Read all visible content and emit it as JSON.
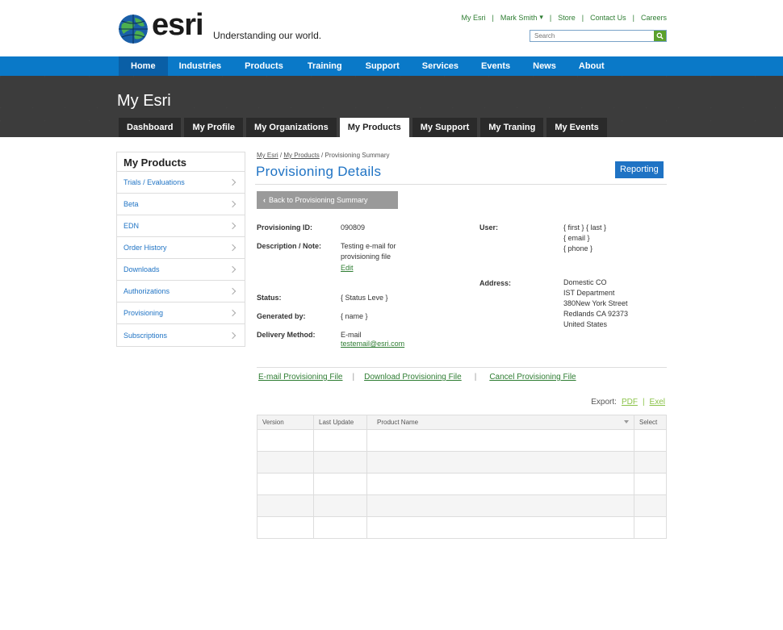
{
  "header": {
    "logo_word": "esri",
    "tagline": "Understanding our world.",
    "top_links": [
      "My Esri",
      "Mark Smith",
      "Store",
      "Contact Us",
      "Careers"
    ],
    "search_placeholder": "Search"
  },
  "main_nav": [
    "Home",
    "Industries",
    "Products",
    "Training",
    "Support",
    "Services",
    "Events",
    "News",
    "About"
  ],
  "band": {
    "title": "My Esri",
    "tabs": [
      "Dashboard",
      "My Profile",
      "My Organizations",
      "My Products",
      "My Support",
      "My Traning",
      "My Events"
    ]
  },
  "sidebar": {
    "title": "My Products",
    "items": [
      "Trials / Evaluations",
      "Beta",
      "EDN",
      "Order History",
      "Downloads",
      "Authorizations",
      "Provisioning",
      "Subscriptions"
    ]
  },
  "breadcrumb": {
    "c1": "My Esri",
    "c2": "My Products",
    "c3": "Provisioning Summary"
  },
  "page": {
    "title": "Provisioning Details",
    "reporting": "Reporting",
    "back": "Back to Provisioning Summary"
  },
  "details": {
    "prov_id_label": "Provisioning ID:",
    "prov_id": "090809",
    "desc_label": "Description / Note:",
    "desc_1": "Testing e-mail for",
    "desc_2": "provisioning file",
    "edit": "Edit",
    "status_label": "Status:",
    "status": "{ Status Leve }",
    "generated_label": "Generated by:",
    "generated": "{ name }",
    "delivery_label": "Delivery Method:",
    "delivery": "E-mail",
    "delivery_email": "testemail@esri.com",
    "user_label": "User:",
    "user_1": "{ first } { last }",
    "user_2": "{ email }",
    "user_3": "{ phone }",
    "address_label": "Address:",
    "address_1": "Domestic CO",
    "address_2": "IST Department",
    "address_3": "380New York Street",
    "address_4": "Redlands CA 92373",
    "address_5": "United States"
  },
  "actions": [
    "E-mail Provisioning File",
    "Download Provisioning File",
    "Cancel Provisioning File"
  ],
  "export": {
    "label": "Export:",
    "pdf": "PDF",
    "excel": "Exel"
  },
  "table": {
    "columns": [
      "Version",
      "Last Update",
      "Product Name",
      "Select"
    ]
  },
  "colors": {
    "nav_blue": "#0a79c8",
    "link_green": "#2e7d32",
    "title_blue": "#1f73c4"
  }
}
